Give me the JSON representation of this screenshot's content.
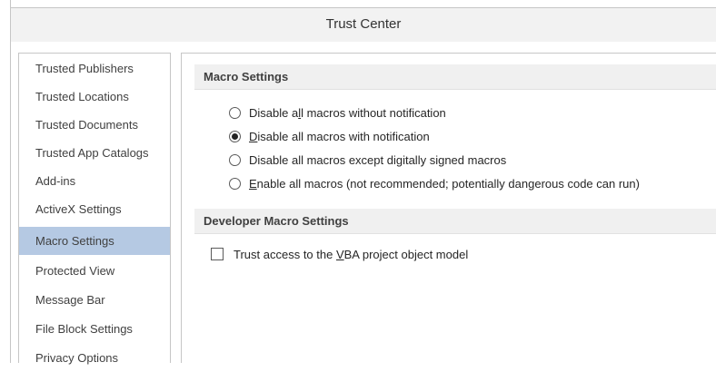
{
  "window": {
    "title": "Trust Center"
  },
  "sidebar": {
    "items": [
      {
        "label": "Trusted Publishers"
      },
      {
        "label": "Trusted Locations"
      },
      {
        "label": "Trusted Documents"
      },
      {
        "label": "Trusted App Catalogs"
      },
      {
        "label": "Add-ins"
      },
      {
        "label": "ActiveX Settings"
      },
      {
        "label": "Macro Settings",
        "selected": true
      },
      {
        "label": "Protected View"
      },
      {
        "label": "Message Bar"
      },
      {
        "label": "File Block Settings"
      },
      {
        "label": "Privacy Options"
      }
    ]
  },
  "macro_settings": {
    "header": "Macro Settings",
    "options": [
      {
        "pre": "Disable a",
        "key": "l",
        "post": "l macros without notification",
        "checked": false
      },
      {
        "pre": "",
        "key": "D",
        "post": "isable all macros with notification",
        "checked": true
      },
      {
        "pre": "Disable all macros except digitally signed macros",
        "key": "",
        "post": "",
        "checked": false
      },
      {
        "pre": "",
        "key": "E",
        "post": "nable all macros (not recommended; potentially dangerous code can run)",
        "checked": false
      }
    ]
  },
  "developer": {
    "header": "Developer Macro Settings",
    "vba_checkbox": {
      "pre": "Trust access to the ",
      "key": "V",
      "post": "BA project object model",
      "checked": false
    }
  },
  "colors": {
    "selected_nav": "#b5c9e3",
    "title_bar": "#f2f2f2",
    "section_header": "#f0f0f0"
  }
}
